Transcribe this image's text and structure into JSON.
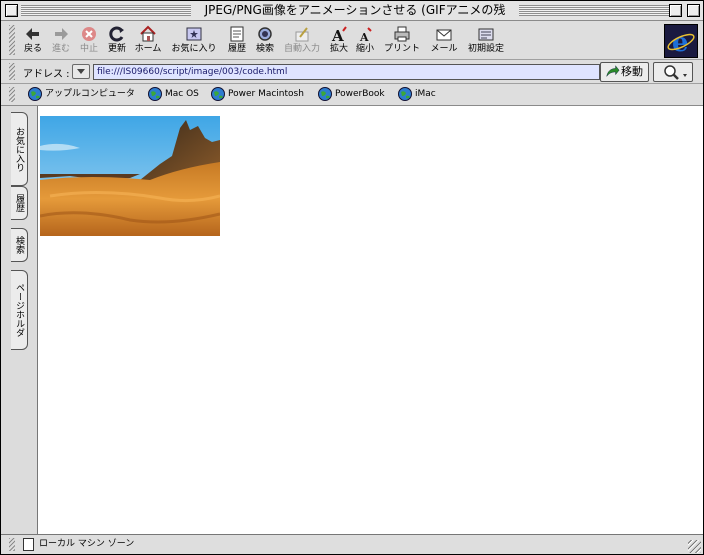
{
  "window": {
    "title": "JPEG/PNG画像をアニメーションさせる (GIFアニメの残"
  },
  "toolbar": {
    "buttons": [
      {
        "label": "戻る",
        "icon": "back-arrow-icon",
        "enabled": true
      },
      {
        "label": "進む",
        "icon": "forward-arrow-icon",
        "enabled": false
      },
      {
        "label": "中止",
        "icon": "stop-icon",
        "enabled": false
      },
      {
        "label": "更新",
        "icon": "refresh-icon",
        "enabled": true
      },
      {
        "label": "ホーム",
        "icon": "home-icon",
        "enabled": true
      },
      {
        "label": "お気に入り",
        "icon": "favorites-icon",
        "enabled": true
      },
      {
        "label": "履歴",
        "icon": "history-icon",
        "enabled": true
      },
      {
        "label": "検索",
        "icon": "search-icon",
        "enabled": true
      },
      {
        "label": "自動入力",
        "icon": "autofill-icon",
        "enabled": false
      },
      {
        "label": "拡大",
        "icon": "text-larger-icon",
        "enabled": true
      },
      {
        "label": "縮小",
        "icon": "text-smaller-icon",
        "enabled": true
      },
      {
        "label": "プリント",
        "icon": "print-icon",
        "enabled": true
      },
      {
        "label": "メール",
        "icon": "mail-icon",
        "enabled": true
      },
      {
        "label": "初期設定",
        "icon": "preferences-icon",
        "enabled": true
      }
    ]
  },
  "address": {
    "label": "アドレス :",
    "url": "file:///IS09660/script/image/003/code.html",
    "go_label": "移動"
  },
  "favorites": [
    {
      "label": "アップルコンピュータ"
    },
    {
      "label": "Mac OS"
    },
    {
      "label": "Power Macintosh"
    },
    {
      "label": "PowerBook"
    },
    {
      "label": "iMac"
    }
  ],
  "side_tabs": [
    {
      "label": "お気に入り"
    },
    {
      "label": "履歴"
    },
    {
      "label": "検索"
    },
    {
      "label": "ページホルダ"
    }
  ],
  "status": {
    "zone": "ローカル マシン ゾーン"
  },
  "colors": {
    "address_field": "#dfe4ff",
    "sky": "#6cc0e8",
    "desert": "#d88a2a",
    "ie_blue": "#1e6fd8"
  }
}
